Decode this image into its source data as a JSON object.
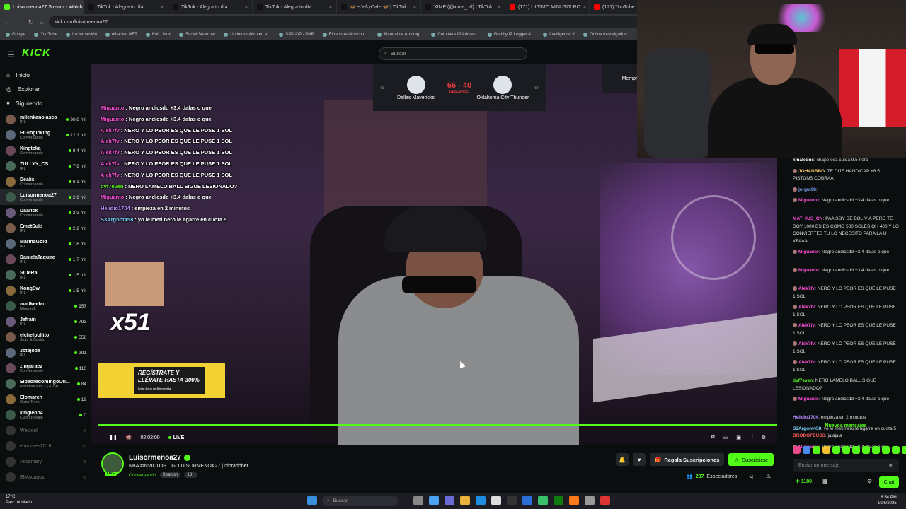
{
  "browser": {
    "tabs": [
      {
        "label": "Luisormenoa27 Stream - Watch",
        "color": "#53fc18",
        "active": true
      },
      {
        "label": "TikTok - Alegra tu día",
        "color": "#111111"
      },
      {
        "label": "TikTok - Alegra tu día",
        "color": "#111111"
      },
      {
        "label": "TikTok - Alegra tu día",
        "color": "#111111"
      },
      {
        "label": "🦋 ~JefryCal~ 🦋 | TikTok",
        "color": "#111111"
      },
      {
        "label": "XIME (@xime_.al) | TikTok",
        "color": "#111111"
      },
      {
        "label": "(171) ÚLTIMO MINUTO! RO",
        "color": "#ff0000"
      },
      {
        "label": "(171) YouTube",
        "color": "#ff0000"
      }
    ],
    "url": "kick.com/luisormenoa27",
    "bookmarks": [
      "Google",
      "YouTube",
      "Iniciar sesión",
      "elhacker.NET",
      "Kali Linux",
      "Social Searcher",
      "Un informático en e...",
      "SIPCOP - PNP",
      "El reporte técnico d...",
      "Manual de Armitag...",
      "Complete IP Addres...",
      "Grabify IP Logger &...",
      "Intelligence X",
      "Online investigation..."
    ]
  },
  "header": {
    "logo": "KICK",
    "search_placeholder": "Buscar"
  },
  "sidebar": {
    "nav": [
      {
        "label": "Inicio",
        "icon": "home-icon"
      },
      {
        "label": "Explorar",
        "icon": "compass-icon"
      },
      {
        "label": "Siguiendo",
        "icon": "heart-icon"
      }
    ],
    "channels": [
      {
        "name": "milenkanolasco",
        "cat": "IRL",
        "viewers": "36,8 mil"
      },
      {
        "name": "ElGlogloking",
        "cat": "Conversando",
        "viewers": "12,1 mil"
      },
      {
        "name": "Kingteka",
        "cat": "Conversando",
        "viewers": "8,4 mil"
      },
      {
        "name": "ZULLYY_CS",
        "cat": "IRL",
        "viewers": "7,9 mil"
      },
      {
        "name": "Dealis",
        "cat": "Conversando",
        "viewers": "6,1 mil"
      },
      {
        "name": "Luisormenoa27",
        "cat": "Conversando",
        "viewers": "2,9 mil",
        "selected": true
      },
      {
        "name": "Daarick",
        "cat": "Conversando",
        "viewers": "2,3 mil"
      },
      {
        "name": "EmetSuki",
        "cat": "IRL",
        "viewers": "2,2 mil"
      },
      {
        "name": "MarinaGold",
        "cat": "IRL",
        "viewers": "1,8 mil"
      },
      {
        "name": "DanielaTaquire",
        "cat": "IRL",
        "viewers": "1,7 mil"
      },
      {
        "name": "SiDeRaL",
        "cat": "IRL",
        "viewers": "1,5 mil"
      },
      {
        "name": "KongSw",
        "cat": "IRL",
        "viewers": "1,5 mil"
      },
      {
        "name": "mattkeelan",
        "cat": "Minecraft",
        "viewers": "957"
      },
      {
        "name": "Jefrain",
        "cat": "IRL",
        "viewers": "793"
      },
      {
        "name": "elchefpollito",
        "cat": "Slots & Casino",
        "viewers": "556"
      },
      {
        "name": "Jotajoda",
        "cat": "IRL",
        "viewers": "291"
      },
      {
        "name": "zingaraez",
        "cat": "Conversando",
        "viewers": "110"
      },
      {
        "name": "ElpadredomingoOfi...",
        "cat": "Resident Evil 2 (2019)",
        "viewers": "84"
      },
      {
        "name": "Elomarch",
        "cat": "Outer Terror",
        "viewers": "19"
      },
      {
        "name": "kingleon4",
        "cat": "Clash Royale",
        "viewers": "0"
      },
      {
        "name": "Westcol",
        "cat": "",
        "viewers": "",
        "offline": true
      },
      {
        "name": "elmodres2016",
        "cat": "",
        "viewers": "",
        "offline": true
      },
      {
        "name": "Accamary",
        "cat": "",
        "viewers": "",
        "offline": true
      },
      {
        "name": "ElMacarius",
        "cat": "",
        "viewers": "",
        "offline": true
      }
    ]
  },
  "player": {
    "overlay_chat": [
      {
        "user": "Miguanto",
        "color": "#ff4fd8",
        "text": ": Negro andicsdd +3.4 dalas o que"
      },
      {
        "user": "Miguanto",
        "color": "#ff4fd8",
        "text": ": Negro andicsdd +3.4 dalas o que"
      },
      {
        "user": "Alek7fv",
        "color": "#ff4fd8",
        "text": ": NERO Y LO PEOR ES QUE LE PUSE 1 SOL"
      },
      {
        "user": "Alek7fv",
        "color": "#ff4fd8",
        "text": ": NERO Y LO PEOR ES QUE LE PUSE 1 SOL"
      },
      {
        "user": "Alek7fv",
        "color": "#ff4fd8",
        "text": ": NERO Y LO PEOR ES QUE LE PUSE 1 SOL"
      },
      {
        "user": "Alek7fv",
        "color": "#ff4fd8",
        "text": ": NERO Y LO PEOR ES QUE LE PUSE 1 SOL"
      },
      {
        "user": "Alek7fv",
        "color": "#ff4fd8",
        "text": ": NERO Y LO PEOR ES QUE LE PUSE 1 SOL"
      },
      {
        "user": "dyf7even",
        "color": "#53fc18",
        "text": ": NERO LAMELO BALL SIGUE LESIONADO?"
      },
      {
        "user": "Miguanto",
        "color": "#ff4fd8",
        "text": ": Negro andicsdd +3.4 dalas o que"
      },
      {
        "user": "Helidio1704",
        "color": "#b98cff",
        "text": ": empieza en 2 minutos"
      },
      {
        "user": "S3Argont458",
        "color": "#7fd7ff",
        "text": ": yo le meti nero le agarre en cuota 5"
      }
    ],
    "scoreboard": {
      "team1": "Dallas Mavericks",
      "team2": "Oklahoma City Thunder",
      "score": "66 - 40",
      "status": "DESCANSO",
      "team3": "Memphis"
    },
    "meme_multiplier": "x51",
    "ad_text": "REGÍSTRATE Y LLÉVATE HASTA 300%",
    "ad_small": "En tu Bono de Bienvenida",
    "time": "02:02:00",
    "live": "LIVE",
    "progress": 1.0
  },
  "streamer": {
    "name": "Luisormenoa27",
    "title": "NBA #INVICTOS | IG: LUISORMENOA27 | !doradobet",
    "category": "Conversando",
    "tags": [
      "Spanish",
      "18+"
    ],
    "gift_label": "Regala Suscripciones",
    "subscribe_label": "Suscribirse",
    "viewers": "287",
    "viewers_label": "Espectadores",
    "live_badge": "LIVE"
  },
  "chat": {
    "messages": [
      {
        "user": "kmaleons",
        "color": "#ffffff",
        "text": ": chape esa cuida 9.5 nero"
      },
      {
        "user": "JOHANBBG",
        "color": "#ffd36b",
        "text": ": TE DIJE HANDICAP +8.5 PISTONS COBRAA"
      },
      {
        "user": "jergui98",
        "color": "#7fa6ff",
        "text": ":"
      },
      {
        "user": "Miguanto",
        "color": "#ff4fd8",
        "text": ": Negro andicsdd +3.4 dalas o que"
      },
      {
        "user": "MATHIUS_ON",
        "color": "#ff4fd8",
        "text": ": PAA SOY DE BOLIVIA PERO TE DOY 1000 BS ES COMO 500 SOLES OH 400 Y LO CONVIERTES TU LO NECESITO PARA LA U XFAAA"
      },
      {
        "user": "Miguanto",
        "color": "#ff4fd8",
        "text": ": Negro andicsdd +3.4 dalas o que"
      },
      {
        "user": "Miguanto",
        "color": "#ff4fd8",
        "text": ": Negro andicsdd +3.4 dalas o que"
      },
      {
        "user": "Alek7fv",
        "color": "#ff4fd8",
        "text": ": NERO Y LO PEOR ES QUE LE PUSE 1 SOL"
      },
      {
        "user": "Alek7fv",
        "color": "#ff4fd8",
        "text": ": NERO Y LO PEOR ES QUE LE PUSE 1 SOL"
      },
      {
        "user": "Alek7fv",
        "color": "#ff4fd8",
        "text": ": NERO Y LO PEOR ES QUE LE PUSE 1 SOL"
      },
      {
        "user": "Alek7fv",
        "color": "#ff4fd8",
        "text": ": NERO Y LO PEOR ES QUE LE PUSE 1 SOL"
      },
      {
        "user": "Alek7fv",
        "color": "#ff4fd8",
        "text": ": NERO Y LO PEOR ES QUE LE PUSE 1 SOL"
      },
      {
        "user": "dyf7even",
        "color": "#53fc18",
        "text": ": NERO LAMELO BALL SIGUE LESIONADO?"
      },
      {
        "user": "Miguanto",
        "color": "#ff4fd8",
        "text": ": Negro andicsdd +3.4 dalas o que"
      },
      {
        "user": "Helidio1704",
        "color": "#b98cff",
        "text": ": empieza en 2 minutos"
      },
      {
        "user": "S3Argont458",
        "color": "#7fd7ff",
        "text": ": yo le meti nero le agarre en cuota 5"
      },
      {
        "user": "Miguanto",
        "color": "#ff4fd8",
        "text": ": Negro andicsdd +3.4 dalas o que"
      }
    ],
    "new_messages_label": "Nuevos mensajes",
    "last": {
      "user": "DRODOFEUSS",
      "color": "#ff5a5a",
      "text": ": jajajaja"
    },
    "input_placeholder": "Enviar un mensaje",
    "points": "1180",
    "chat_button": "Chat"
  },
  "taskbar": {
    "weather_temp": "17°C",
    "weather_desc": "Parc. nublado",
    "search_placeholder": "Buscar",
    "time": "8:54 PM",
    "date": "10/6/2025"
  }
}
